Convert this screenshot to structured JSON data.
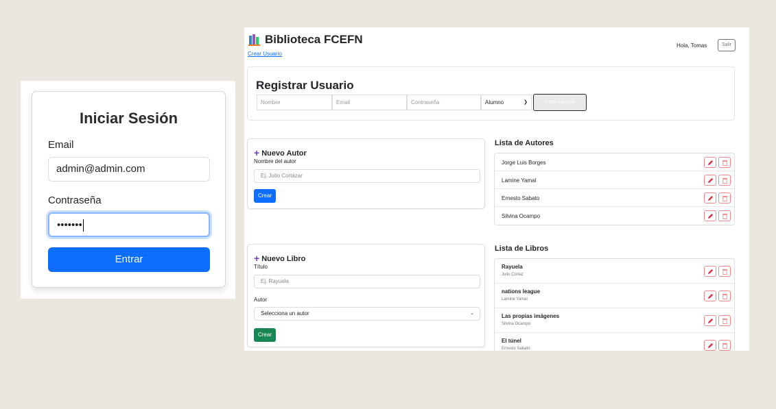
{
  "login": {
    "title": "Iniciar Sesión",
    "email_label": "Email",
    "email_value": "admin@admin.com",
    "password_label": "Contraseña",
    "password_value": "•••••••",
    "submit_label": "Entrar"
  },
  "header": {
    "brand": "Biblioteca FCEFN",
    "create_user_link": "Crear Usuario",
    "greeting": "Hola, Tomas",
    "logout_label": "Salir"
  },
  "register": {
    "title": "Registrar Usuario",
    "name_placeholder": "Nombre",
    "email_placeholder": "Email",
    "password_placeholder": "Contraseña",
    "role_value": "Alumno",
    "submit_label": "Crear Usuario"
  },
  "author_form": {
    "title": "Nuevo Autor",
    "name_label": "Nombre del autor",
    "name_placeholder": "Ej. Julio Cortázar",
    "submit_label": "Crear"
  },
  "book_form": {
    "title": "Nuevo Libro",
    "title_label": "Título",
    "title_placeholder": "Ej. Rayuela",
    "author_label": "Autor",
    "author_select_value": "Selecciona un autor",
    "submit_label": "Crear"
  },
  "authors": {
    "title": "Lista de Autores",
    "items": [
      {
        "name": "Jorge Luis Borges"
      },
      {
        "name": "Lamine Yamal"
      },
      {
        "name": "Ernesto Sabato"
      },
      {
        "name": "Silvina Ocampo"
      }
    ]
  },
  "books": {
    "title": "Lista de Libros",
    "items": [
      {
        "title": "Rayuela",
        "author": "Julio Cortaz"
      },
      {
        "title": "nations league",
        "author": "Lamine Yamal"
      },
      {
        "title": "Las propias imágenes",
        "author": "Silvina Ocampo"
      },
      {
        "title": "El túnel",
        "author": "Ernesto Sabato"
      }
    ]
  },
  "icons": {
    "brand": "books-icon",
    "edit": "pencil-icon",
    "delete": "trash-icon",
    "add": "plus-icon",
    "select": "chevron-down-icon"
  },
  "colors": {
    "primary": "#0d6efd",
    "success": "#198754",
    "danger": "#dc3545",
    "accent": "#6f42c1",
    "background": "#ece6e1"
  }
}
